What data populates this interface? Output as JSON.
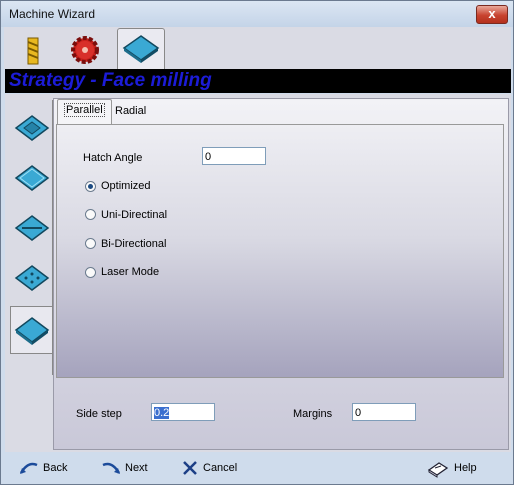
{
  "window": {
    "title": "Machine Wizard",
    "close_label": "x"
  },
  "top_tabs": [
    {
      "icon": "drill-bit-icon"
    },
    {
      "icon": "red-gear-icon"
    },
    {
      "icon": "blue-plate-icon",
      "active": true
    }
  ],
  "banner": {
    "title": "Strategy - Face milling"
  },
  "side_tabs": [
    {
      "icon": "pocket-plate-icon"
    },
    {
      "icon": "outline-plate-icon"
    },
    {
      "icon": "slot-plate-icon"
    },
    {
      "icon": "drill-plate-icon"
    },
    {
      "icon": "face-plate-icon",
      "active": true
    }
  ],
  "sub_tabs": {
    "parallel": "Parallel",
    "radial": "Radial"
  },
  "form": {
    "hatch_angle_label": "Hatch Angle",
    "hatch_angle_value": "0",
    "options": [
      {
        "label": "Optimized",
        "checked": true
      },
      {
        "label": "Uni-Directinal",
        "checked": false
      },
      {
        "label": "Bi-Directional",
        "checked": false
      },
      {
        "label": "Laser Mode",
        "checked": false
      }
    ],
    "side_step_label": "Side step",
    "side_step_value": "0.2",
    "margins_label": "Margins",
    "margins_value": "0"
  },
  "footer": {
    "back": "Back",
    "next": "Next",
    "cancel": "Cancel",
    "help": "Help"
  },
  "colors": {
    "banner_bg": "#000000",
    "banner_text": "#1c1cd8",
    "close_button": "#c8432f"
  }
}
